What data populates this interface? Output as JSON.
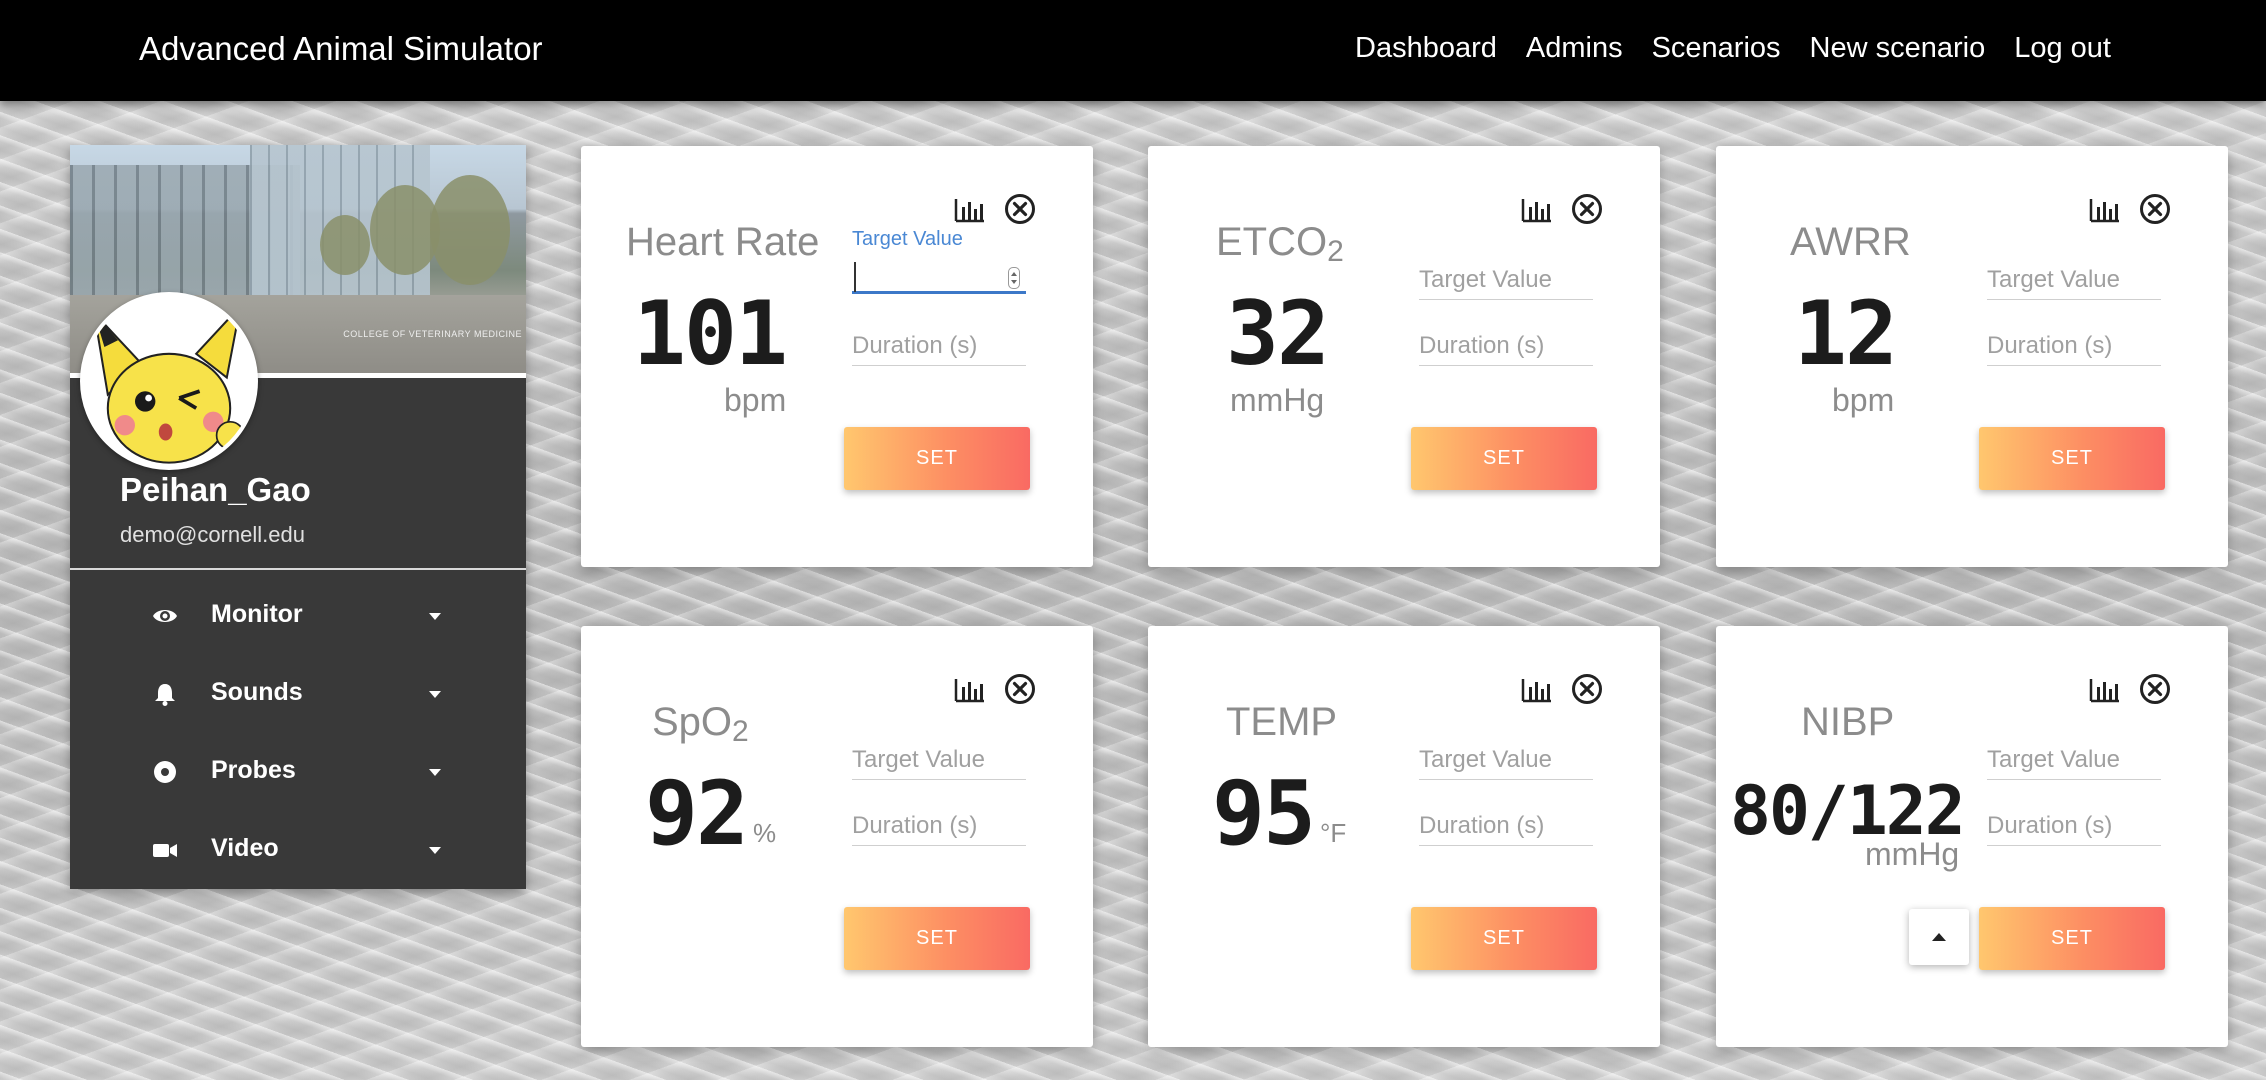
{
  "header": {
    "brand": "Advanced Animal Simulator",
    "nav": [
      "Dashboard",
      "Admins",
      "Scenarios",
      "New scenario",
      "Log out"
    ]
  },
  "profile": {
    "cover_caption": "COLLEGE OF VETERINARY MEDICINE",
    "username": "Peihan_Gao",
    "email": "demo@cornell.edu"
  },
  "sidebar": {
    "items": [
      {
        "label": "Monitor",
        "icon": "eye-icon"
      },
      {
        "label": "Sounds",
        "icon": "bell-icon"
      },
      {
        "label": "Probes",
        "icon": "record-icon"
      },
      {
        "label": "Video",
        "icon": "video-camera-icon"
      }
    ]
  },
  "cards": [
    {
      "id": "heart-rate",
      "title": "Heart Rate",
      "value": "101",
      "unit": "bpm",
      "target_label": "Target Value",
      "target_placeholder": "",
      "duration_placeholder": "Duration (s)",
      "set_label": "SET",
      "active": true
    },
    {
      "id": "etco2",
      "title": "ETCO",
      "title_sub": "2",
      "value": "32",
      "unit": "mmHg",
      "target_placeholder": "Target Value",
      "duration_placeholder": "Duration (s)",
      "set_label": "SET"
    },
    {
      "id": "awrr",
      "title": "AWRR",
      "value": "12",
      "unit": "bpm",
      "target_placeholder": "Target Value",
      "duration_placeholder": "Duration (s)",
      "set_label": "SET"
    },
    {
      "id": "spo2",
      "title": "SpO",
      "title_sub": "2",
      "value": "92",
      "unit": "%",
      "target_placeholder": "Target Value",
      "duration_placeholder": "Duration (s)",
      "set_label": "SET"
    },
    {
      "id": "temp",
      "title": "TEMP",
      "value": "95",
      "unit": "°F",
      "target_placeholder": "Target Value",
      "duration_placeholder": "Duration (s)",
      "set_label": "SET"
    },
    {
      "id": "nibp",
      "title": "NIBP",
      "value": "80/122",
      "unit": "mmHg",
      "target_placeholder": "Target Value",
      "duration_placeholder": "Duration (s)",
      "set_label": "SET"
    }
  ],
  "colors": {
    "topbar": "#000000",
    "sidebar": "#393939",
    "button_gradient_start": "#ffc76e",
    "button_gradient_end": "#f96a63",
    "focus_blue": "#3c78c8"
  }
}
